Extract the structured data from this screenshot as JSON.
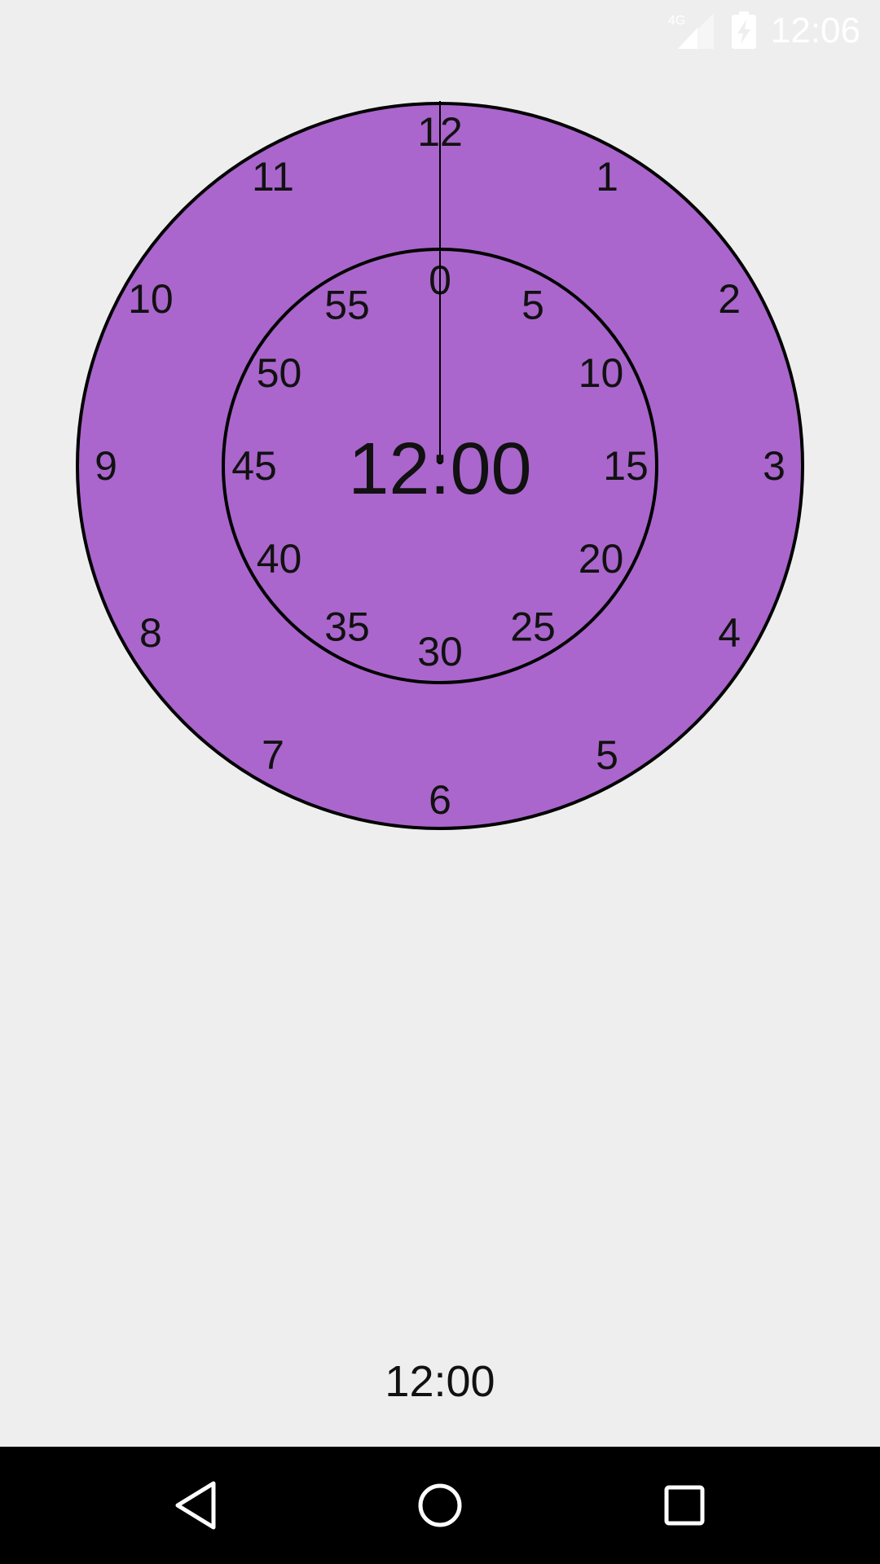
{
  "status_bar": {
    "time": "12:06",
    "network_label": "4G",
    "icons": [
      "signal-icon",
      "battery-charging-icon"
    ],
    "text_color": "#FFFFFF"
  },
  "clock": {
    "face_color": "#AA66CC",
    "outline_color": "#000000",
    "center_time": "12:00",
    "hour_labels": [
      "12",
      "1",
      "2",
      "3",
      "4",
      "5",
      "6",
      "7",
      "8",
      "9",
      "10",
      "11"
    ],
    "minute_labels": [
      "0",
      "5",
      "10",
      "15",
      "20",
      "25",
      "30",
      "35",
      "40",
      "45",
      "50",
      "55"
    ],
    "hand_minute_value": 0
  },
  "bottom": {
    "time_text": "12:00"
  },
  "nav_bar": {
    "background": "#000000",
    "buttons": [
      "back-icon",
      "home-icon",
      "recents-icon"
    ]
  }
}
